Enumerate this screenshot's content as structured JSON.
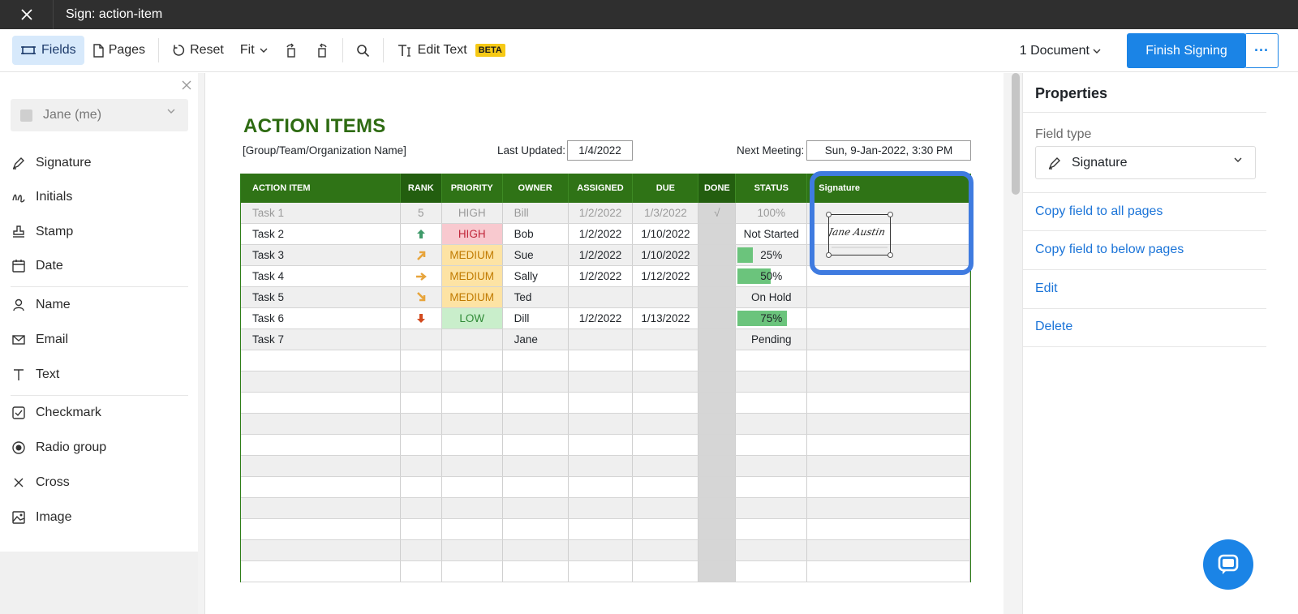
{
  "window": {
    "title": "Sign: action-item"
  },
  "toolbar": {
    "fields": "Fields",
    "pages": "Pages",
    "reset": "Reset",
    "fit": "Fit",
    "edit_text": "Edit Text",
    "beta": "BETA",
    "documents": "1 Document",
    "finish": "Finish Signing"
  },
  "left": {
    "signer": "Jane (me)",
    "fields": [
      {
        "label": "Signature",
        "icon": "pen-icon"
      },
      {
        "label": "Initials",
        "icon": "initials-icon"
      },
      {
        "label": "Stamp",
        "icon": "stamp-icon"
      },
      {
        "label": "Date",
        "icon": "calendar-icon"
      },
      {
        "label": "Name",
        "icon": "person-icon"
      },
      {
        "label": "Email",
        "icon": "envelope-icon"
      },
      {
        "label": "Text",
        "icon": "text-icon"
      },
      {
        "label": "Checkmark",
        "icon": "checkbox-icon"
      },
      {
        "label": "Radio group",
        "icon": "radio-icon"
      },
      {
        "label": "Cross",
        "icon": "cross-icon"
      },
      {
        "label": "Image",
        "icon": "image-icon"
      }
    ]
  },
  "doc": {
    "title": "ACTION ITEMS",
    "org": "[Group/Team/Organization Name]",
    "last_updated_label": "Last Updated:",
    "last_updated": "1/4/2022",
    "next_meeting_label": "Next Meeting:",
    "next_meeting": "Sun, 9-Jan-2022, 3:30 PM",
    "headers": [
      "ACTION ITEM",
      "RANK",
      "PRIORITY",
      "OWNER",
      "ASSIGNED",
      "DUE",
      "DONE",
      "STATUS",
      "Signature"
    ],
    "rows": [
      {
        "item": "Task 1",
        "rank": "5",
        "priority": "HIGH",
        "owner": "Bill",
        "assigned": "1/2/2022",
        "due": "1/3/2022",
        "done": "√",
        "status": "100%"
      },
      {
        "item": "Task 2",
        "rank": "",
        "priority": "HIGH",
        "owner": "Bob",
        "assigned": "1/2/2022",
        "due": "1/10/2022",
        "done": "",
        "status": "Not Started"
      },
      {
        "item": "Task 3",
        "rank": "",
        "priority": "MEDIUM",
        "owner": "Sue",
        "assigned": "1/2/2022",
        "due": "1/10/2022",
        "done": "",
        "status": "25%"
      },
      {
        "item": "Task 4",
        "rank": "",
        "priority": "MEDIUM",
        "owner": "Sally",
        "assigned": "1/2/2022",
        "due": "1/12/2022",
        "done": "",
        "status": "50%"
      },
      {
        "item": "Task 5",
        "rank": "",
        "priority": "MEDIUM",
        "owner": "Ted",
        "assigned": "",
        "due": "",
        "done": "",
        "status": "On Hold"
      },
      {
        "item": "Task 6",
        "rank": "",
        "priority": "LOW",
        "owner": "Dill",
        "assigned": "1/2/2022",
        "due": "1/13/2022",
        "done": "",
        "status": "75%"
      },
      {
        "item": "Task 7",
        "rank": "",
        "priority": "",
        "owner": "Jane",
        "assigned": "",
        "due": "",
        "done": "",
        "status": "Pending"
      }
    ],
    "signature_text": "Jane Austin"
  },
  "right": {
    "title": "Properties",
    "field_type_label": "Field type",
    "field_type": "Signature",
    "links": [
      "Copy field to all pages",
      "Copy field to below pages",
      "Edit",
      "Delete"
    ]
  },
  "colors": {
    "accent": "#1b84e6",
    "doc_green": "#2f7316",
    "highlight": "#3f7be0"
  }
}
